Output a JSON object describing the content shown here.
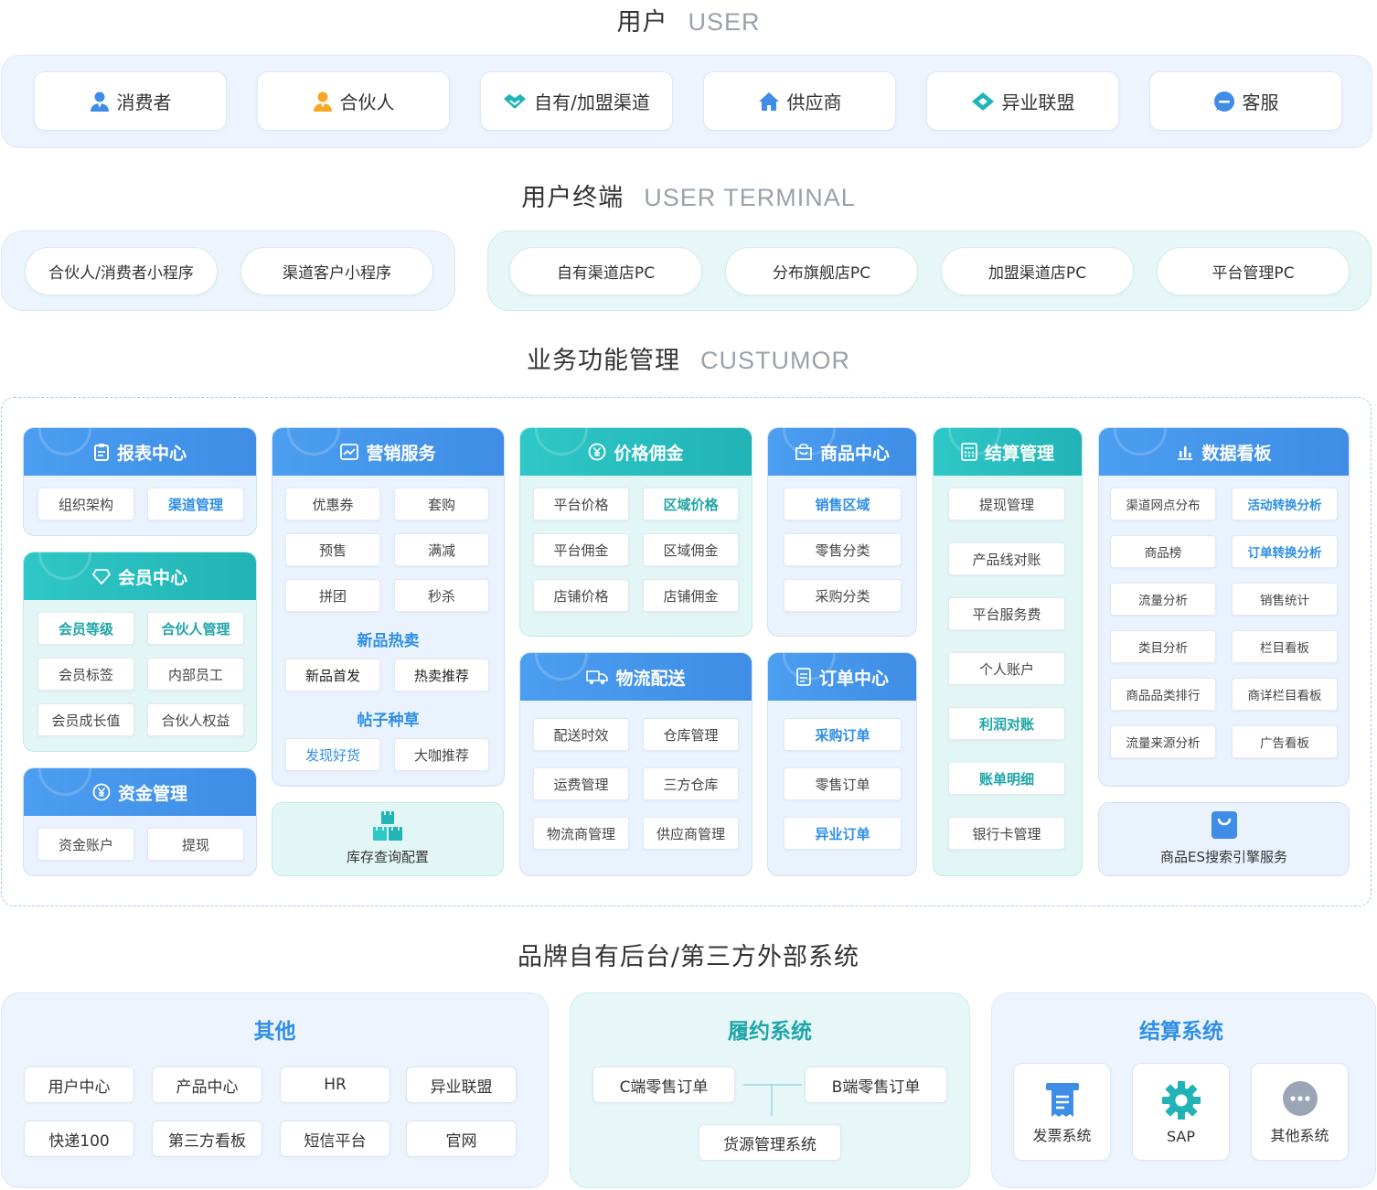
{
  "sections": {
    "user": {
      "title": "用户",
      "en": "USER"
    },
    "terminal": {
      "title": "用户终端",
      "en": "USER TERMINAL"
    },
    "business": {
      "title": "业务功能管理",
      "en": "CUSTUMOR"
    },
    "backend": {
      "title": "品牌自有后台/第三方外部系统",
      "en": ""
    }
  },
  "users": [
    {
      "label": "消费者",
      "icon": "person-icon"
    },
    {
      "label": "合伙人",
      "icon": "partner-icon"
    },
    {
      "label": "自有/加盟渠道",
      "icon": "handshake-icon"
    },
    {
      "label": "供应商",
      "icon": "home-icon"
    },
    {
      "label": "异业联盟",
      "icon": "diamond-link-icon"
    },
    {
      "label": "客服",
      "icon": "chat-bubble-icon"
    }
  ],
  "terminals": {
    "mini": [
      "合伙人/消费者小程序",
      "渠道客户小程序"
    ],
    "pc": [
      "自有渠道店PC",
      "分布旗舰店PC",
      "加盟渠道店PC",
      "平台管理PC"
    ]
  },
  "modules": {
    "report": {
      "title": "报表中心",
      "items": [
        "组织架构",
        "渠道管理"
      ]
    },
    "member": {
      "title": "会员中心",
      "items": [
        "会员等级",
        "合伙人管理",
        "会员标签",
        "内部员工",
        "会员成长值",
        "合伙人权益"
      ]
    },
    "fund": {
      "title": "资金管理",
      "items": [
        "资金账户",
        "提现"
      ]
    },
    "marketing": {
      "title": "营销服务",
      "items": [
        "优惠券",
        "套购",
        "预售",
        "满减",
        "拼团",
        "秒杀"
      ],
      "sub1": "新品热卖",
      "sub1_items": [
        "新品首发",
        "热卖推荐"
      ],
      "sub2": "帖子种草",
      "sub2_items": [
        "发现好货",
        "大咖推荐"
      ]
    },
    "inventory": {
      "label": "库存查询配置"
    },
    "price": {
      "title": "价格佣金",
      "items": [
        "平台价格",
        "区域价格",
        "平台佣金",
        "区域佣金",
        "店铺价格",
        "店铺佣金"
      ]
    },
    "logistics": {
      "title": "物流配送",
      "items": [
        "配送时效",
        "仓库管理",
        "运费管理",
        "三方仓库",
        "物流商管理",
        "供应商管理"
      ]
    },
    "goods": {
      "title": "商品中心",
      "items": [
        "销售区域",
        "零售分类",
        "采购分类"
      ]
    },
    "order": {
      "title": "订单中心",
      "items": [
        "采购订单",
        "零售订单",
        "异业订单"
      ]
    },
    "settle": {
      "title": "结算管理",
      "items": [
        "提现管理",
        "产品线对账",
        "平台服务费",
        "个人账户",
        "利润对账",
        "账单明细",
        "银行卡管理"
      ]
    },
    "dashboard": {
      "title": "数据看板",
      "items": [
        "渠道网点分布",
        "活动转换分析",
        "商品榜",
        "订单转换分析",
        "流量分析",
        "销售统计",
        "类目分析",
        "栏目看板",
        "商品品类排行",
        "商详栏目看板",
        "流量来源分析",
        "广告看板"
      ]
    },
    "search": {
      "label": "商品ES搜索引擎服务"
    }
  },
  "backend": {
    "other": {
      "title": "其他",
      "items": [
        "用户中心",
        "产品中心",
        "HR",
        "异业联盟",
        "快递100",
        "第三方看板",
        "短信平台",
        "官网"
      ]
    },
    "fulfill": {
      "title": "履约系统",
      "items": [
        "C端零售订单",
        "B端零售订单",
        "货源管理系统"
      ]
    },
    "settle": {
      "title": "结算系统",
      "items": [
        "发票系统",
        "SAP",
        "其他系统"
      ]
    }
  },
  "colors": {
    "blue": "#3f8de6",
    "teal": "#21b3b5",
    "highlight": "#2f8fe6",
    "orange": "#f5a623"
  }
}
